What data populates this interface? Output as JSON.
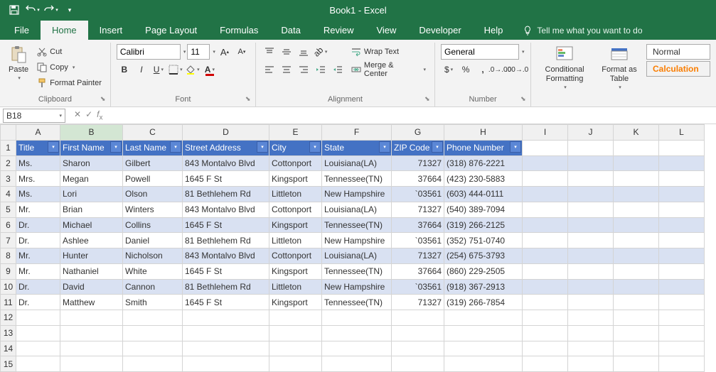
{
  "app": {
    "title": "Book1 - Excel"
  },
  "qat": {
    "save": "Save",
    "undo": "Undo",
    "redo": "Redo"
  },
  "tabs": {
    "file": "File",
    "home": "Home",
    "insert": "Insert",
    "page_layout": "Page Layout",
    "formulas": "Formulas",
    "data": "Data",
    "review": "Review",
    "view": "View",
    "developer": "Developer",
    "help": "Help",
    "tell_me": "Tell me what you want to do"
  },
  "ribbon": {
    "clipboard": {
      "label": "Clipboard",
      "paste": "Paste",
      "cut": "Cut",
      "copy": "Copy",
      "format_painter": "Format Painter"
    },
    "font": {
      "label": "Font",
      "name": "Calibri",
      "size": "11"
    },
    "alignment": {
      "label": "Alignment",
      "wrap": "Wrap Text",
      "merge": "Merge & Center"
    },
    "number": {
      "label": "Number",
      "format": "General"
    },
    "styles": {
      "conditional": "Conditional Formatting",
      "format_table": "Format as Table",
      "normal": "Normal",
      "calculation": "Calculation"
    }
  },
  "formula_bar": {
    "name_box": "B18",
    "formula": ""
  },
  "columns": [
    "A",
    "B",
    "C",
    "D",
    "E",
    "F",
    "G",
    "H",
    "I",
    "J",
    "K",
    "L"
  ],
  "headers": [
    "Title",
    "First Name",
    "Last Name",
    "Street Address",
    "City",
    "State",
    "ZIP Code",
    "Phone Number"
  ],
  "chart_data": {
    "type": "table",
    "columns": [
      "Title",
      "First Name",
      "Last Name",
      "Street Address",
      "City",
      "State",
      "ZIP Code",
      "Phone Number"
    ],
    "rows": [
      [
        "Ms.",
        "Sharon",
        "Gilbert",
        "843 Montalvo Blvd",
        "Cottonport",
        "Louisiana(LA)",
        "71327",
        "(318) 876-2221"
      ],
      [
        "Mrs.",
        "Megan",
        "Powell",
        "1645 F St",
        "Kingsport",
        "Tennessee(TN)",
        "37664",
        "(423) 230-5883"
      ],
      [
        "Ms.",
        "Lori",
        "Olson",
        "81 Bethlehem Rd",
        "Littleton",
        "New Hampshire",
        "`03561",
        "(603) 444-0111"
      ],
      [
        "Mr.",
        "Brian",
        "Winters",
        "843 Montalvo Blvd",
        "Cottonport",
        "Louisiana(LA)",
        "71327",
        "(540) 389-7094"
      ],
      [
        "Dr.",
        "Michael",
        "Collins",
        "1645 F St",
        "Kingsport",
        "Tennessee(TN)",
        "37664",
        "(319) 266-2125"
      ],
      [
        "Dr.",
        "Ashlee",
        "Daniel",
        "81 Bethlehem Rd",
        "Littleton",
        "New Hampshire",
        "`03561",
        "(352) 751-0740"
      ],
      [
        "Mr.",
        "Hunter",
        "Nicholson",
        "843 Montalvo Blvd",
        "Cottonport",
        "Louisiana(LA)",
        "71327",
        "(254) 675-3793"
      ],
      [
        "Mr.",
        "Nathaniel",
        "White",
        "1645 F St",
        "Kingsport",
        "Tennessee(TN)",
        "37664",
        "(860) 229-2505"
      ],
      [
        "Dr.",
        "David",
        "Cannon",
        "81 Bethlehem Rd",
        "Littleton",
        "New Hampshire",
        "`03561",
        "(918) 367-2913"
      ],
      [
        "Dr.",
        "Matthew",
        "Smith",
        "1645 F St",
        "Kingsport",
        "Tennessee(TN)",
        "71327",
        "(319) 266-7854"
      ]
    ]
  }
}
